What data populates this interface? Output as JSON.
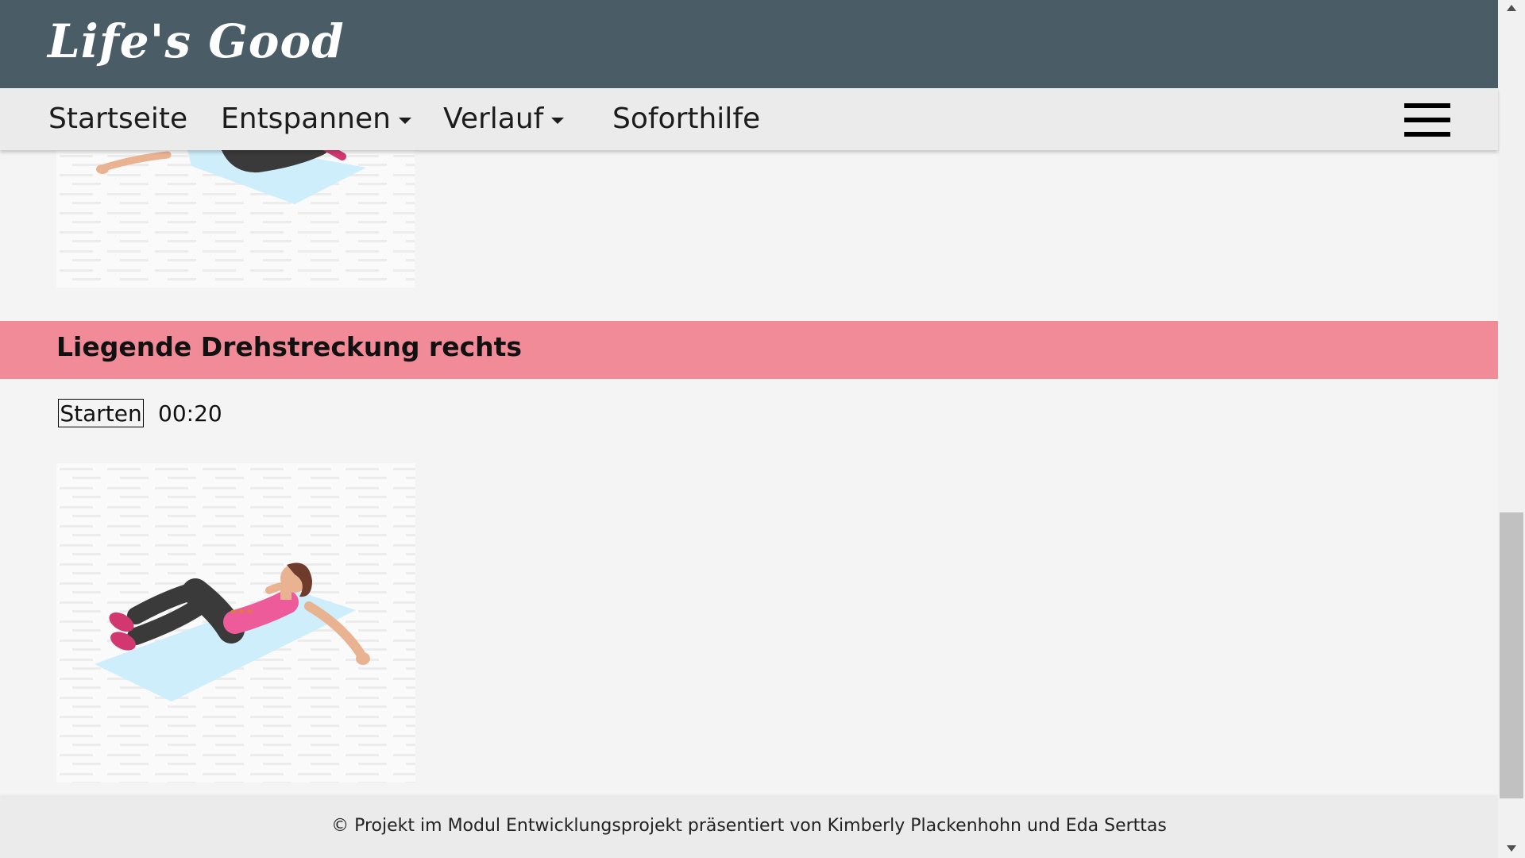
{
  "header": {
    "logo": "Life's Good"
  },
  "nav": {
    "items": [
      {
        "label": "Startseite",
        "dropdown": false
      },
      {
        "label": "Entspannen",
        "dropdown": true
      },
      {
        "label": "Verlauf",
        "dropdown": true
      },
      {
        "label": "Soforthilfe",
        "dropdown": false
      }
    ],
    "menu_icon": "hamburger-icon"
  },
  "exercise": {
    "title": "Liegende Drehstreckung rechts",
    "start_label": "Starten",
    "timer": "00:20"
  },
  "footer": {
    "text": "© Projekt im Modul Entwicklungsprojekt präsentiert von Kimberly Plackenhohn und Eda Serttas"
  },
  "colors": {
    "header_bg": "#4a5d67",
    "navbar_bg": "#ebebeb",
    "heading_bg": "#f28b98",
    "page_bg": "#f4f4f4",
    "mat": "#cdeefa",
    "top_pink": "#ee5b9b"
  }
}
